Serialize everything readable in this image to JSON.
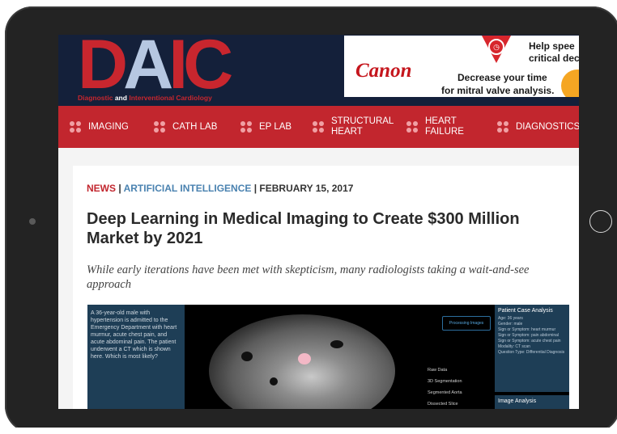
{
  "header": {
    "logo_d": "D",
    "logo_a": "A",
    "logo_ic": "IC",
    "logo_sub_1": "Diagnostic",
    "logo_sub_and": "and",
    "logo_sub_2": "Interventional Cardiology"
  },
  "ad": {
    "brand": "Canon",
    "line1": "Help spee",
    "line2": "critical deci",
    "line3": "Decrease your time",
    "line4": "for mitral valve analysis."
  },
  "nav": {
    "items": [
      {
        "label": "IMAGING"
      },
      {
        "label": "CATH LAB"
      },
      {
        "label": "EP LAB"
      },
      {
        "label_1": "STRUCTURAL",
        "label_2": "HEART"
      },
      {
        "label_1": "HEART",
        "label_2": "FAILURE"
      },
      {
        "label": "DIAGNOSTICS"
      }
    ]
  },
  "article": {
    "section": "NEWS",
    "sep1": " | ",
    "category": "ARTIFICIAL INTELLIGENCE",
    "sep2": " | ",
    "date": "FEBRUARY 15, 2017",
    "title": "Deep Learning in Medical Imaging to Create $300 Million Market by 2021",
    "subtitle": "While early iterations have been met with skepticism, many radiologists taking a wait-and-see approach"
  },
  "figure": {
    "case_text": "A 36-year-old male with hypertension is admitted to the Emergency Department with heart murmur, acute chest pain, and acute abdominal pain. The patient underwent a CT which is shown here. Which is most likely?",
    "process_button": "Processing Images",
    "menu": [
      "Raw Data",
      "3D Segmentation",
      "Segmented Aorta",
      "Dissected Slice"
    ],
    "panel_title": "Patient Case Analysis",
    "panel_lines": [
      "Age: 36 years",
      "Gender: male",
      "Sign or Symptom: heart murmur",
      "Sign or Symptom: pain abdominal",
      "Sign or Symptom: acute chest pain",
      "Modality: CT scan",
      "Question Type: Differential Diagnosis"
    ],
    "panel2_title": "Image Analysis"
  }
}
